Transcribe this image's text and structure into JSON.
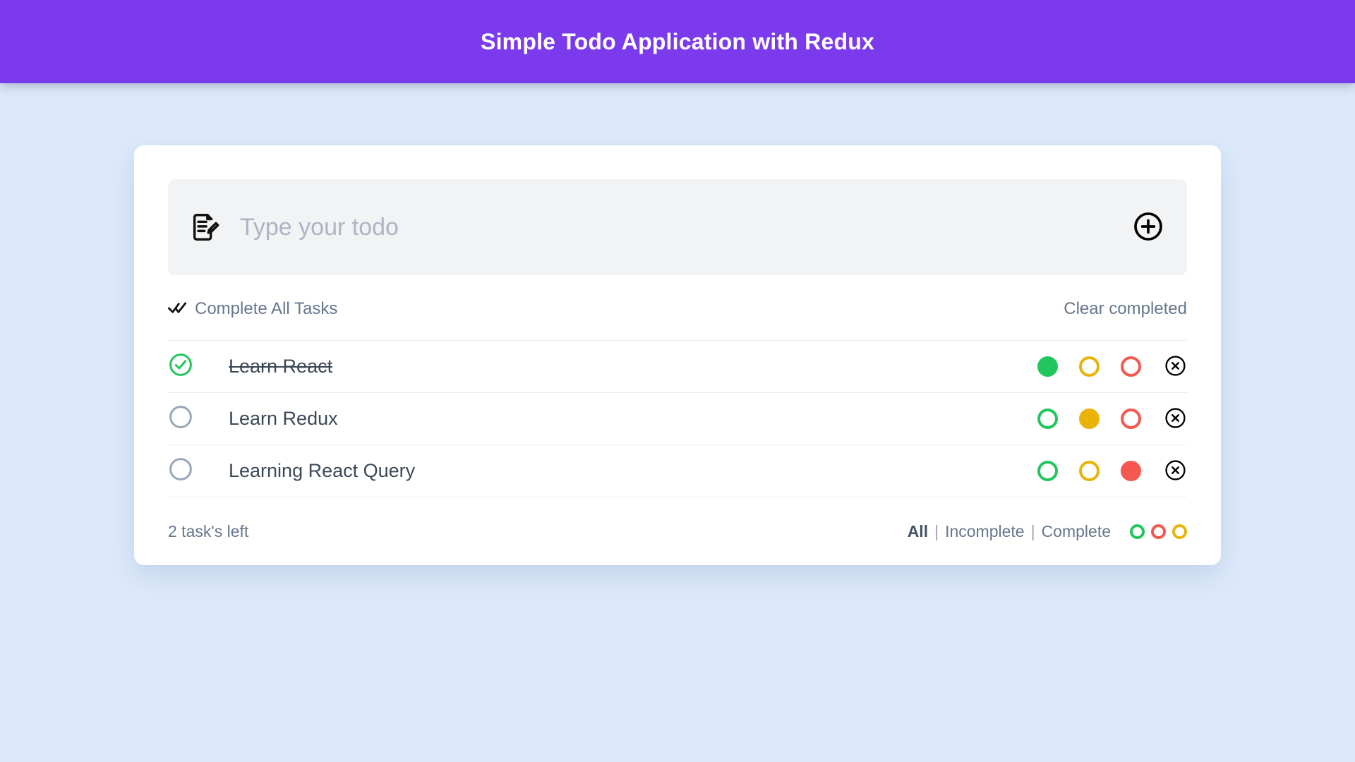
{
  "header": {
    "title": "Simple Todo Application with Redux",
    "background_color": "#7c3aed",
    "text_color": "#ffffff"
  },
  "page": {
    "background_color": "#dce9fb",
    "card_background": "#ffffff"
  },
  "input_bar": {
    "icon": "note-pencil-icon",
    "placeholder": "Type your todo",
    "value": "",
    "add_button_icon": "plus-circle-icon",
    "background_color": "#f2f3f5"
  },
  "toolbar": {
    "complete_all_icon": "double-check-icon",
    "complete_all_label": "Complete All Tasks",
    "clear_completed_label": "Clear completed"
  },
  "todos": [
    {
      "label": "Learn React",
      "completed": true,
      "checkbox_icon": "check-circle-icon",
      "priority": "green",
      "dots": [
        {
          "color": "green",
          "hex": "#22c55e",
          "filled": true
        },
        {
          "color": "yellow",
          "hex": "#eab308",
          "filled": false
        },
        {
          "color": "red",
          "hex": "#f4584f",
          "filled": false
        }
      ],
      "delete_icon": "x-circle-icon"
    },
    {
      "label": "Learn Redux",
      "completed": false,
      "checkbox_icon": "empty-circle-icon",
      "priority": "yellow",
      "dots": [
        {
          "color": "green",
          "hex": "#22c55e",
          "filled": false
        },
        {
          "color": "yellow",
          "hex": "#eab308",
          "filled": true
        },
        {
          "color": "red",
          "hex": "#f4584f",
          "filled": false
        }
      ],
      "delete_icon": "x-circle-icon"
    },
    {
      "label": "Learning React Query",
      "completed": false,
      "checkbox_icon": "empty-circle-icon",
      "priority": "red",
      "dots": [
        {
          "color": "green",
          "hex": "#22c55e",
          "filled": false
        },
        {
          "color": "yellow",
          "hex": "#eab308",
          "filled": false
        },
        {
          "color": "red",
          "hex": "#f4584f",
          "filled": true
        }
      ],
      "delete_icon": "x-circle-icon"
    }
  ],
  "footer": {
    "tasks_left": "2 task's left",
    "filters": [
      {
        "label": "All",
        "active": true
      },
      {
        "label": "Incomplete",
        "active": false
      },
      {
        "label": "Complete",
        "active": false
      }
    ],
    "separator": "|",
    "color_filters": [
      {
        "color": "green",
        "hex": "#22c55e"
      },
      {
        "color": "red",
        "hex": "#f4584f"
      },
      {
        "color": "yellow",
        "hex": "#eab308"
      }
    ]
  },
  "colors": {
    "accent": "#7c3aed",
    "green": "#22c55e",
    "yellow": "#eab308",
    "red": "#f4584f",
    "text": "#3c4858",
    "muted": "#67768c",
    "placeholder": "#adb5c4",
    "divider": "#e9ecef",
    "checkbox_empty": "#9aa6b8"
  }
}
